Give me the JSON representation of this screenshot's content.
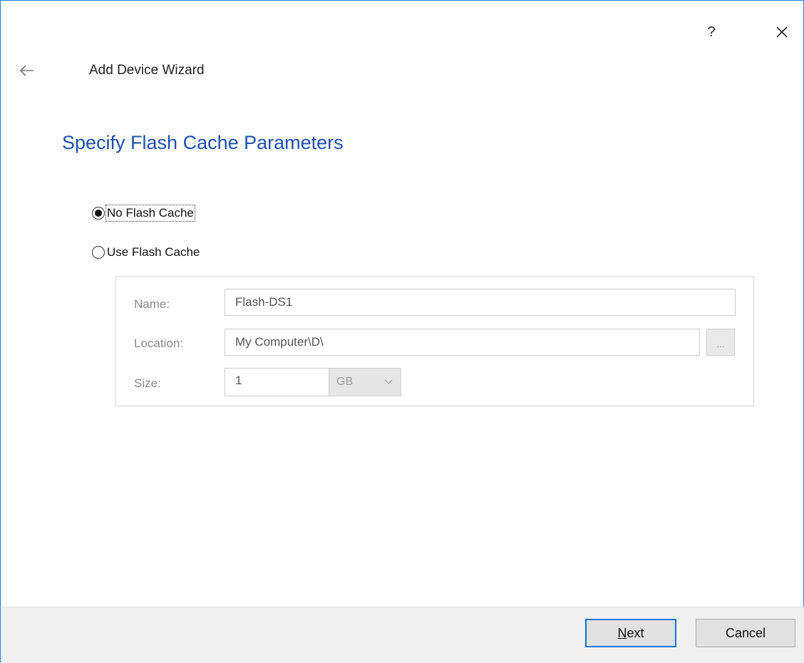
{
  "titlebar": {
    "help_label": "?"
  },
  "header": {
    "wizard_title": "Add Device Wizard"
  },
  "page": {
    "heading": "Specify Flash Cache Parameters"
  },
  "options": {
    "no_flash_cache": "No Flash Cache",
    "use_flash_cache": "Use Flash Cache",
    "selected": "no_flash_cache"
  },
  "form": {
    "name_label": "Name:",
    "name_value": "Flash-DS1",
    "location_label": "Location:",
    "location_value": "My Computer\\D\\",
    "browse_label": "...",
    "size_label": "Size:",
    "size_value": "1",
    "size_unit": "GB"
  },
  "footer": {
    "next_label": "Next",
    "cancel_label": "Cancel"
  },
  "colors": {
    "accent": "#0078d7",
    "heading": "#1f4fb0",
    "window_border": "#1e7fd8"
  }
}
